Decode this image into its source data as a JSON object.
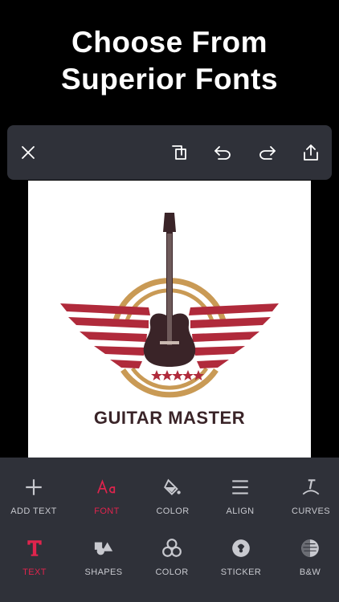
{
  "headline": {
    "line1": "Choose From",
    "line2": "Superior Fonts"
  },
  "toolbar": {
    "close_icon": "close-icon",
    "duplicate_icon": "duplicate-icon",
    "undo_icon": "undo-icon",
    "redo_icon": "redo-icon",
    "share_icon": "share-icon"
  },
  "canvas": {
    "logo_text": "GUITAR MASTER"
  },
  "tools_row1": [
    {
      "label": "ADD TEXT",
      "icon": "plus-icon"
    },
    {
      "label": "FONT",
      "icon": "font-icon"
    },
    {
      "label": "COLOR",
      "icon": "paint-bucket-icon"
    },
    {
      "label": "ALIGN",
      "icon": "align-icon"
    },
    {
      "label": "CURVES",
      "icon": "curve-text-icon"
    }
  ],
  "tools_row2": [
    {
      "label": "TEXT",
      "icon": "text-icon"
    },
    {
      "label": "SHAPES",
      "icon": "shapes-icon"
    },
    {
      "label": "COLOR",
      "icon": "color-wheel-icon"
    },
    {
      "label": "STICKER",
      "icon": "sticker-icon"
    },
    {
      "label": "B&W",
      "icon": "black-white-icon"
    }
  ],
  "colors": {
    "accent": "#e0244d",
    "panel": "#2f3139",
    "logo_red": "#b02a3b",
    "logo_gold": "#c99a55",
    "logo_dark": "#3a2428"
  }
}
